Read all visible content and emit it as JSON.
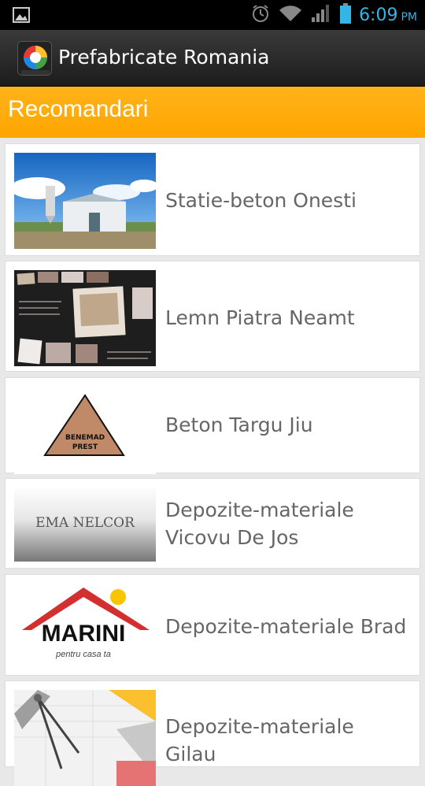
{
  "status_bar": {
    "time": "6:09",
    "ampm": "PM",
    "icons": [
      "image-notification-icon",
      "alarm-icon",
      "wifi-icon",
      "signal-icon",
      "battery-icon"
    ]
  },
  "action_bar": {
    "app_title": "Prefabricate Romania",
    "app_icon": "app-logo-icon"
  },
  "section": {
    "title": "Recomandari",
    "accent_color": "#ffa500"
  },
  "items": [
    {
      "label": "Statie-beton Onesti",
      "thumb": "concrete-plant-photo"
    },
    {
      "label": "Lemn Piatra Neamt",
      "thumb": "kitchen-collage-photo"
    },
    {
      "label": "Beton Targu Jiu",
      "thumb": "benemad-logo",
      "thumb_text": [
        "BENEMAD",
        "PREST"
      ]
    },
    {
      "label": "Depozite-materiale Vicovu De Jos",
      "thumb": "ema-nelcor-logo",
      "thumb_text": [
        "EMA NELCOR"
      ]
    },
    {
      "label": "Depozite-materiale Brad",
      "thumb": "marini-logo",
      "thumb_text": [
        "MARINI",
        "pentru casa ta"
      ]
    },
    {
      "label": "Depozite-materiale Gilau",
      "thumb": "architect-tools-photo"
    }
  ]
}
